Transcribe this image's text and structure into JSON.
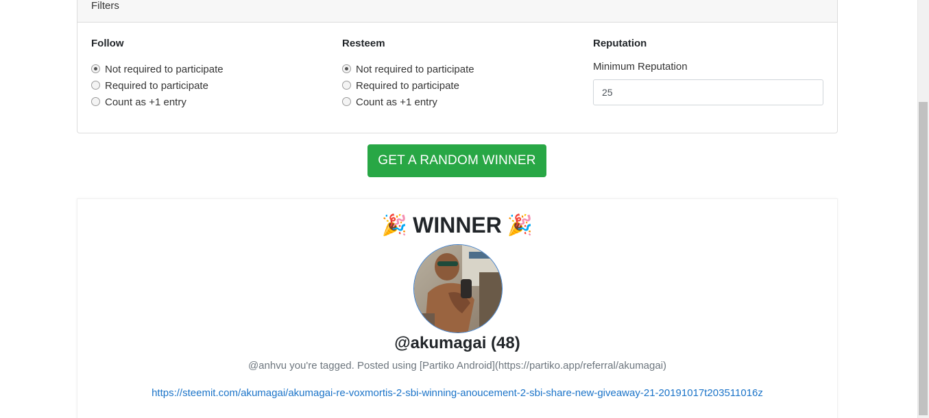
{
  "filters": {
    "header": "Filters",
    "follow": {
      "title": "Follow",
      "options": [
        "Not required to participate",
        "Required to participate",
        "Count as +1 entry"
      ],
      "selected": "Not required to participate"
    },
    "resteem": {
      "title": "Resteem",
      "options": [
        "Not required to participate",
        "Required to participate",
        "Count as +1 entry"
      ],
      "selected": "Not required to participate"
    },
    "reputation": {
      "title": "Reputation",
      "label": "Minimum Reputation",
      "value": "25"
    }
  },
  "action": {
    "button_label": "GET A RANDOM WINNER",
    "button_color": "#28a745"
  },
  "winner": {
    "icon_left": "party-popper-icon",
    "icon_right": "party-popper-icon",
    "heading": "WINNER",
    "username": "@akumagai (48)",
    "comment": "@anhvu you're tagged. Posted using [Partiko Android](https://partiko.app/referral/akumagai)",
    "link": "https://steemit.com/akumagai/akumagai-re-voxmortis-2-sbi-winning-anoucement-2-sbi-share-new-giveaway-21-20191017t203511016z",
    "link_color": "#1a73c8"
  }
}
